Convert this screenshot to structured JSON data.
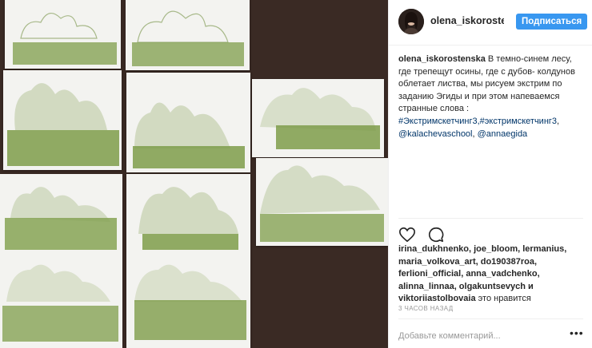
{
  "post": {
    "username": "olena_iskorostenskа",
    "follow_label": "Подписаться",
    "caption": {
      "username": "olena_iskorostenska",
      "text": "В темно-синем лесу, где трепещут осины, где с дубов- колдунов облетает листва, мы рисуем экстрим по заданию Эгиды и при этом напеваемся странные слова :",
      "hashtags": "#Экстримскетчинг3,#экстримскетчинг3",
      "mention1": "@kalachevaschool",
      "mention2": "@annaegida"
    },
    "likes": {
      "text": "irina_dukhnenko, joe_bloom, lermanius, maria_volkova_art, do190387roa, ferlioni_official, anna_vadchenko, alinna_linnaa, olgakuntsevych и viktoriiastolbovaia",
      "suffix": "это нравится"
    },
    "time": "3 ЧАСОВ НАЗАД",
    "comment_placeholder": "Добавьте комментарий...",
    "more_label": "•••"
  },
  "icons": {
    "like": "heart-icon",
    "comment": "comment-icon",
    "more": "more-options-icon"
  },
  "colors": {
    "accent": "#3897f0",
    "link": "#003569",
    "sketch_green": "#7e9c4a",
    "background_wood": "#3a2a24"
  }
}
